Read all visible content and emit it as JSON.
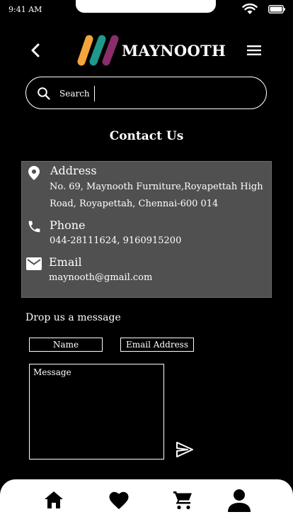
{
  "status": {
    "time": "9:41 AM"
  },
  "header": {
    "brand": "MAYNOOTH"
  },
  "search": {
    "label": "Search"
  },
  "page": {
    "title": "Contact Us"
  },
  "contact": {
    "address_label": "Address",
    "address_line1": "No. 69, Maynooth Furniture,Royapettah High",
    "address_line2": "Road, Royapettah, Chennai-600 014",
    "phone_label": "Phone",
    "phone_value": "044-28111624, 9160915200",
    "email_label": "Email",
    "email_value": "maynooth@gmail.com"
  },
  "form": {
    "heading": "Drop us a message",
    "name_placeholder": "Name",
    "email_placeholder": "Email Address",
    "message_placeholder": "Message"
  },
  "nav": {
    "icons": [
      "home-icon",
      "heart-icon",
      "cart-icon",
      "profile-icon"
    ]
  },
  "colors": {
    "background": "#000000",
    "card": "#505050",
    "logo_orange": "#f4a53b",
    "logo_teal": "#1e9a8c",
    "logo_purple": "#8c2d6b"
  }
}
